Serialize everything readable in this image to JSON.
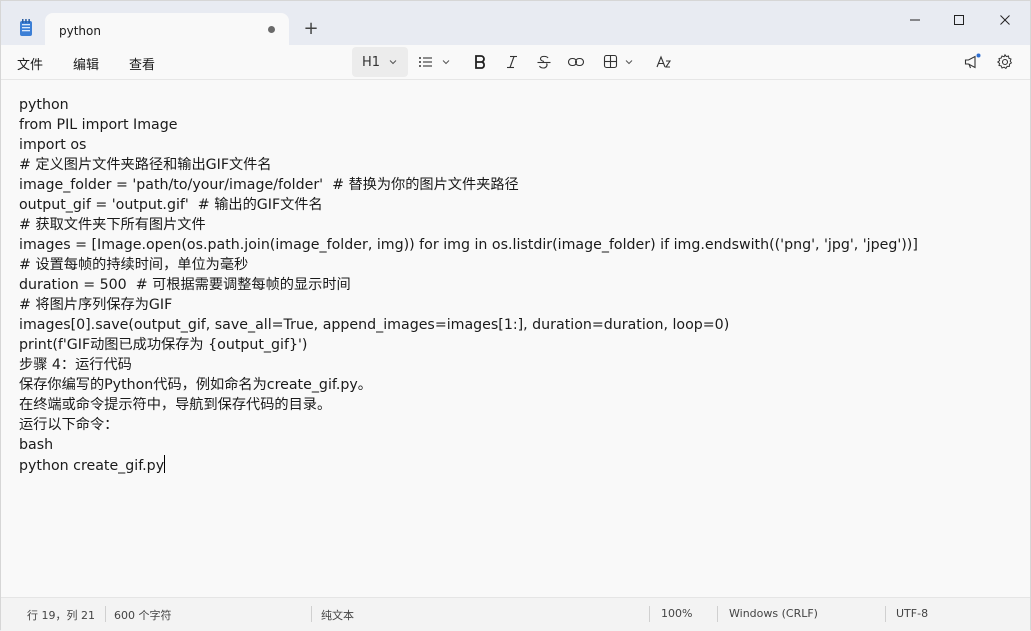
{
  "tab": {
    "title": "python",
    "new_tab_symbol": "+"
  },
  "menu": {
    "file": "文件",
    "edit": "编辑",
    "view": "查看"
  },
  "toolbar": {
    "heading_label": "H1",
    "icons": [
      "list-icon",
      "bold-icon",
      "italic-icon",
      "strikethrough-icon",
      "link-icon",
      "table-icon",
      "clear-format-icon",
      "announcement-icon",
      "settings-icon"
    ]
  },
  "editor": {
    "lines": [
      "python",
      "from PIL import Image",
      "import os",
      "# 定义图片文件夹路径和输出GIF文件名",
      "image_folder = 'path/to/your/image/folder'  # 替换为你的图片文件夹路径",
      "output_gif = 'output.gif'  # 输出的GIF文件名",
      "# 获取文件夹下所有图片文件",
      "images = [Image.open(os.path.join(image_folder, img)) for img in os.listdir(image_folder) if img.endswith(('png', 'jpg', 'jpeg'))]",
      "# 设置每帧的持续时间，单位为毫秒",
      "duration = 500  # 可根据需要调整每帧的显示时间",
      "# 将图片序列保存为GIF",
      "images[0].save(output_gif, save_all=True, append_images=images[1:], duration=duration, loop=0)",
      "print(f'GIF动图已成功保存为 {output_gif}')",
      "步骤 4：运行代码",
      "保存你编写的Python代码，例如命名为create_gif.py。",
      "在终端或命令提示符中，导航到保存代码的目录。",
      "运行以下命令：",
      "bash",
      "python create_gif.py"
    ]
  },
  "status": {
    "position": "行 19，列 21",
    "char_count": "600 个字符",
    "format": "纯文本",
    "zoom": "100%",
    "line_ending": "Windows (CRLF)",
    "encoding": "UTF-8"
  }
}
